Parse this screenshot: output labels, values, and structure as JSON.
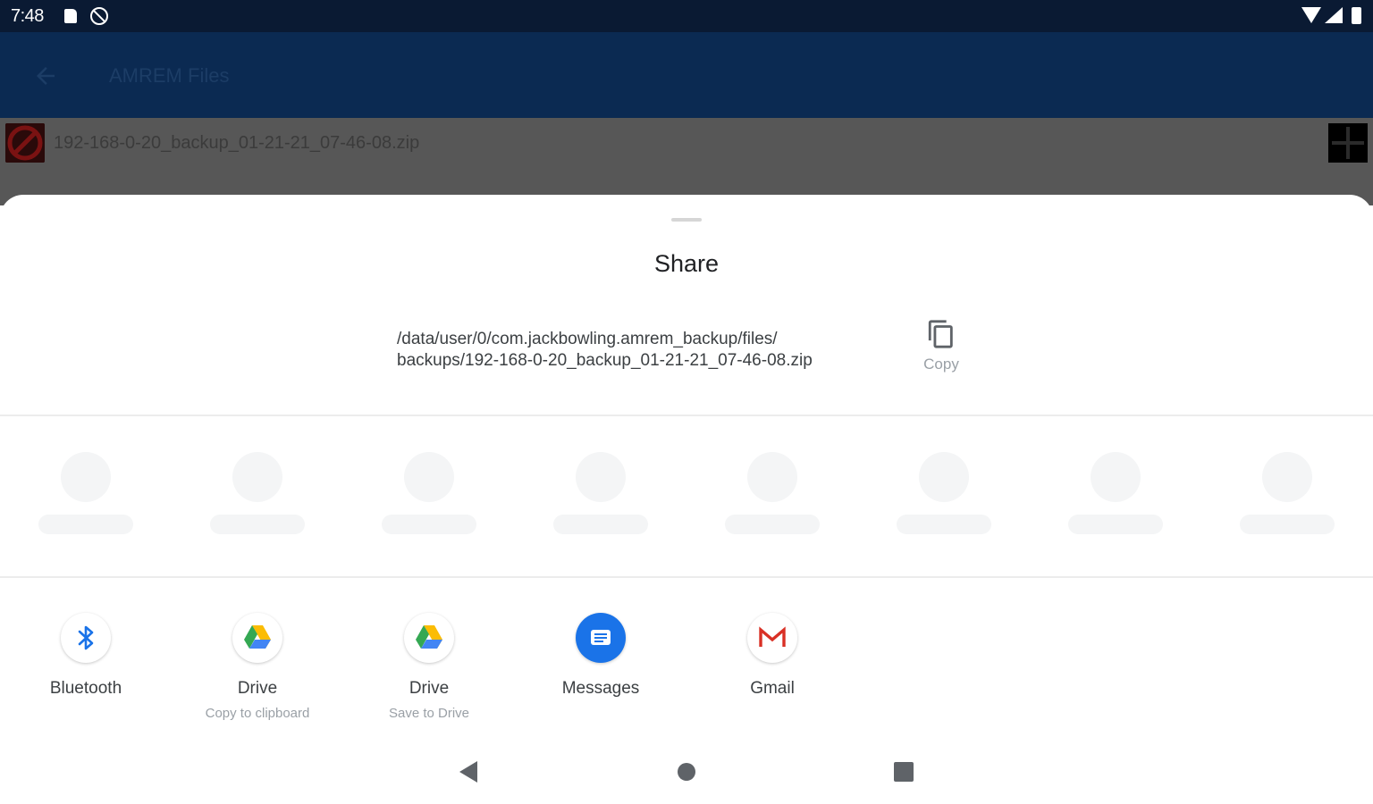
{
  "status_bar": {
    "time": "7:48"
  },
  "app": {
    "title": "AMREM Files",
    "file_name": "192-168-0-20_backup_01-21-21_07-46-08.zip"
  },
  "share": {
    "title": "Share",
    "path_line1": "/data/user/0/com.jackbowling.amrem_backup/files/",
    "path_line2": "backups/192-168-0-20_backup_01-21-21_07-46-08.zip",
    "copy_label": "Copy",
    "targets": [
      {
        "label": "Bluetooth",
        "sub": "",
        "icon": "bluetooth-icon"
      },
      {
        "label": "Drive",
        "sub": "Copy to clipboard",
        "icon": "google-drive-icon"
      },
      {
        "label": "Drive",
        "sub": "Save to Drive",
        "icon": "google-drive-icon"
      },
      {
        "label": "Messages",
        "sub": "",
        "icon": "messages-icon"
      },
      {
        "label": "Gmail",
        "sub": "",
        "icon": "gmail-icon"
      }
    ]
  },
  "colors": {
    "status_bar": "#0a1a33",
    "app_bar": "#0b2a52",
    "scrim_row": "#575757",
    "messages_blue": "#1a73e8",
    "gmail_red": "#d93025"
  }
}
